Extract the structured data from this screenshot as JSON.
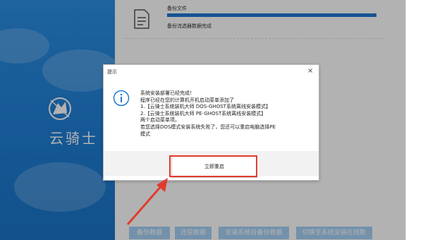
{
  "brand": {
    "name": "云骑士"
  },
  "task": {
    "title": "备份文件",
    "status": "备份流选器数据完成",
    "progress_fraction": 1.0
  },
  "bottom_buttons": [
    "备份数据",
    "还原数据",
    "安装系统目备份数据",
    "切换至系统安装在线数"
  ],
  "dialog": {
    "title": "提示",
    "close_symbol": "×",
    "lines": [
      "系统安装部署已经完成！",
      "程序已经在您的计算机开机启动菜单添加了",
      "1.【云骑士系统装机大师 DOS-GHOST系统离线安装模式】",
      "2.【云骑士系统装机大师 PE-GHOST系统离线安装模式】",
      "两个启动菜单项。",
      "若您选择DOS模式安装系统失败了，您还可以重启电脑选择PE",
      "模式"
    ],
    "button_label": "立即重启"
  },
  "colors": {
    "sidebar": "#1f7fd6",
    "progress": "#1f78d1",
    "highlight": "#e23b2e",
    "info_icon": "#1f78d1"
  },
  "icons": [
    "document-icon",
    "info-icon",
    "close-icon",
    "knight-logo-icon",
    "red-arrow"
  ]
}
